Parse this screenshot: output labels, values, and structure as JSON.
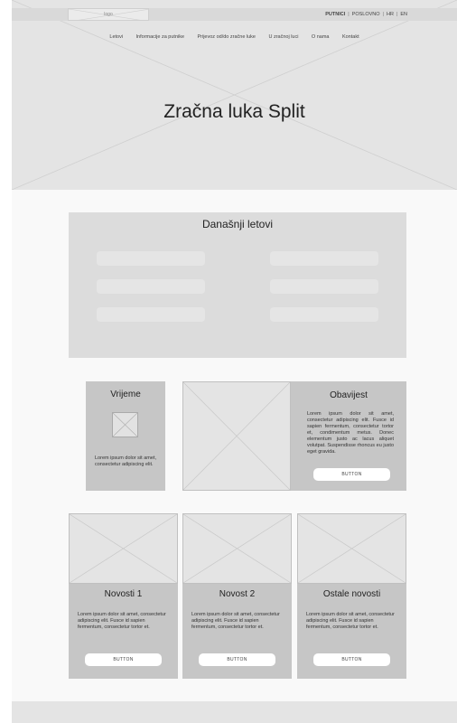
{
  "header": {
    "logo_label": "logo",
    "lang": {
      "passengers": "PUTNICI",
      "business": "POSLOVNO",
      "hr": "HR",
      "en": "EN"
    },
    "nav": [
      "Letovi",
      "Informacije za putnike",
      "Prijevoz od/do zračne luke",
      "U zračnoj luci",
      "O nama",
      "Kontakt"
    ]
  },
  "hero": {
    "title": "Zračna luka Split"
  },
  "flights": {
    "title": "Današnji letovi"
  },
  "weather": {
    "title": "Vrijeme",
    "text": "Lorem ipsum dolor sit amet, consectetur adipiscing elit."
  },
  "notice": {
    "title": "Obavijest",
    "text": "Lorem ipsum dolor sit amet, consectetur adipiscing elit. Fusce id sapien fermentum, consectetur tortor et, condimentum metus. Donec elementum justo ac lacus aliquet volutpat. Suspendisse rhoncus eu justo eget gravida.",
    "button": "BUTTON"
  },
  "news": [
    {
      "title": "Novosti 1",
      "text": "Lorem ipsum dolor sit amet, consectetur adipiscing elit. Fusce id sapien fermentum, consectetur tortor et.",
      "button": "BUTTON"
    },
    {
      "title": "Novost 2",
      "text": "Lorem ipsum dolor sit amet, consectetur adipiscing elit. Fusce id sapien fermentum, consectetur tortor et.",
      "button": "BUTTON"
    },
    {
      "title": "Ostale novosti",
      "text": "Lorem ipsum dolor sit amet, consectetur adipiscing elit. Fusce id sapien fermentum, consectetur tortor et.",
      "button": "BUTTON"
    }
  ]
}
